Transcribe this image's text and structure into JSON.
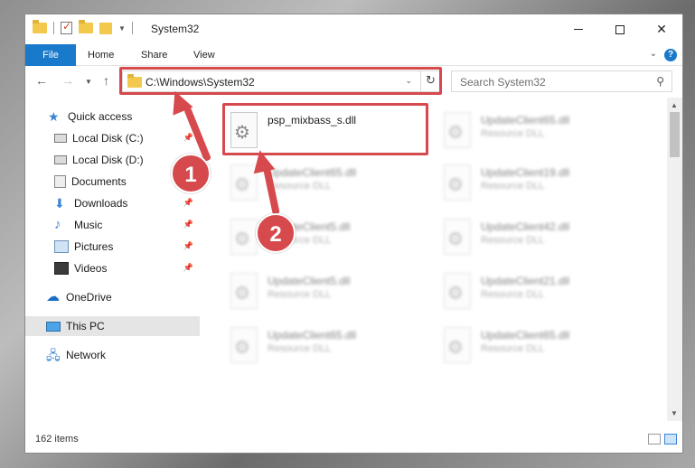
{
  "window": {
    "title": "System32",
    "controls": {
      "minimize": "",
      "maximize": "",
      "close": "✕"
    }
  },
  "ribbon": {
    "tabs": [
      {
        "label": "File"
      },
      {
        "label": "Home"
      },
      {
        "label": "Share"
      },
      {
        "label": "View"
      }
    ],
    "help": "?"
  },
  "address_bar": {
    "path": "C:\\Windows\\System32",
    "refresh": "↻"
  },
  "search": {
    "placeholder": "Search System32"
  },
  "nav_pane": {
    "items": [
      {
        "label": "Quick access",
        "icon": "star-icon",
        "pinned": false
      },
      {
        "label": "Local Disk (C:)",
        "icon": "disk-icon",
        "pinned": true
      },
      {
        "label": "Local Disk (D:)",
        "icon": "disk-icon",
        "pinned": false
      },
      {
        "label": "Documents",
        "icon": "documents-icon",
        "pinned": false
      },
      {
        "label": "Downloads",
        "icon": "download-icon",
        "pinned": true
      },
      {
        "label": "Music",
        "icon": "music-icon",
        "pinned": true
      },
      {
        "label": "Pictures",
        "icon": "pictures-icon",
        "pinned": true
      },
      {
        "label": "Videos",
        "icon": "videos-icon",
        "pinned": true
      },
      {
        "label": "OneDrive",
        "icon": "cloud-icon",
        "pinned": false
      },
      {
        "label": "This PC",
        "icon": "pc-icon",
        "pinned": false,
        "selected": true
      },
      {
        "label": "Network",
        "icon": "network-icon",
        "pinned": false
      }
    ]
  },
  "files": [
    {
      "name": "psp_mixbass_s.dll",
      "type": "",
      "highlighted": true
    },
    {
      "name": "UpdateClient65.dll",
      "type": "Resource DLL"
    },
    {
      "name": "UpdateClient65.dll",
      "type": "Resource DLL"
    },
    {
      "name": "UpdateClient19.dll",
      "type": "Resource DLL"
    },
    {
      "name": "UpdateClient5.dll",
      "type": "Resource DLL"
    },
    {
      "name": "UpdateClient42.dll",
      "type": "Resource DLL"
    },
    {
      "name": "UpdateClient5.dll",
      "type": "Resource DLL"
    },
    {
      "name": "UpdateClient21.dll",
      "type": "Resource DLL"
    },
    {
      "name": "UpdateClient65.dll",
      "type": "Resource DLL"
    },
    {
      "name": "UpdateClient65.dll",
      "type": "Resource DLL"
    }
  ],
  "status": {
    "item_count": "162 items"
  },
  "steps": [
    "1",
    "2"
  ],
  "colors": {
    "accent": "#1979ca",
    "highlight": "#d6494c",
    "selected_bg": "#e5e5e5"
  }
}
